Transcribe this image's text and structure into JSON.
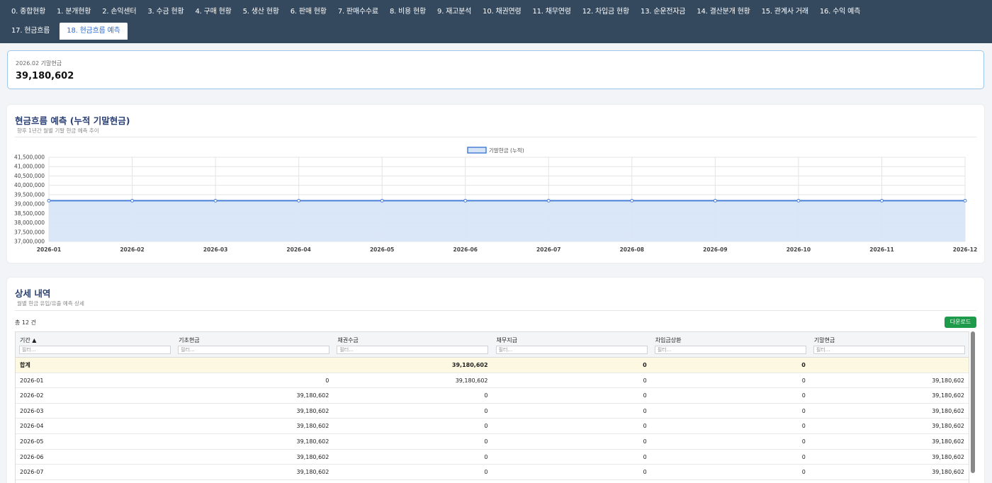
{
  "nav": {
    "tabs_row1": [
      "0. 종합현황",
      "1. 분개현황",
      "2. 손익센터",
      "3. 수금 현황",
      "4. 구매 현황",
      "5. 생산 현황",
      "6. 판매 현황",
      "7. 판매수수료",
      "8. 비용 현황",
      "9. 재고분석",
      "10. 채권연령",
      "11. 채무연령",
      "12. 차입금 현황",
      "13. 순운전자금",
      "14. 결산분개 현황",
      "15. 관계사 거래",
      "16. 수익 예측"
    ],
    "tabs_row2": [
      "17. 현금흐름",
      "18. 현금흐름 예측"
    ],
    "active": "18. 현금흐름 예측"
  },
  "kpi": {
    "label": "2026.02 기말현금",
    "value": "39,180,602"
  },
  "chart_panel": {
    "title": "현금흐름 예측 (누적 기말현금)",
    "subtitle": "향후 1년간 월별 기말 현금 예측 추이"
  },
  "chart_data": {
    "type": "area",
    "categories": [
      "2026-01",
      "2026-02",
      "2026-03",
      "2026-04",
      "2026-05",
      "2026-06",
      "2026-07",
      "2026-08",
      "2026-09",
      "2026-10",
      "2026-11",
      "2026-12"
    ],
    "series": [
      {
        "name": "기말현금 (누적)",
        "values": [
          39180602,
          39180602,
          39180602,
          39180602,
          39180602,
          39180602,
          39180602,
          39180602,
          39180602,
          39180602,
          39180602,
          39180602
        ]
      }
    ],
    "ylim": [
      37000000,
      41500000
    ],
    "yticks": [
      "41,500,000",
      "41,000,000",
      "40,500,000",
      "40,000,000",
      "39,500,000",
      "39,000,000",
      "38,500,000",
      "38,000,000",
      "37,500,000",
      "37,000,000"
    ],
    "grid": true,
    "legend": "top-center",
    "colors": {
      "line": "#4a7fd6",
      "fill": "#d6e4f8"
    }
  },
  "table_panel": {
    "title": "상세 내역",
    "subtitle": "월별 현금 유입/유출 예측 상세",
    "count": "총 12 건",
    "download": "다운로드",
    "columns": [
      "기간 ▲",
      "기초현금",
      "채권수금",
      "채무지급",
      "차입금상환",
      "기말현금"
    ],
    "filter_placeholder": "필터...",
    "total_row": [
      "합계",
      "",
      "39,180,602",
      "0",
      "0",
      ""
    ],
    "rows": [
      [
        "2026-01",
        "0",
        "39,180,602",
        "0",
        "0",
        "39,180,602"
      ],
      [
        "2026-02",
        "39,180,602",
        "0",
        "0",
        "0",
        "39,180,602"
      ],
      [
        "2026-03",
        "39,180,602",
        "0",
        "0",
        "0",
        "39,180,602"
      ],
      [
        "2026-04",
        "39,180,602",
        "0",
        "0",
        "0",
        "39,180,602"
      ],
      [
        "2026-05",
        "39,180,602",
        "0",
        "0",
        "0",
        "39,180,602"
      ],
      [
        "2026-06",
        "39,180,602",
        "0",
        "0",
        "0",
        "39,180,602"
      ],
      [
        "2026-07",
        "39,180,602",
        "0",
        "0",
        "0",
        "39,180,602"
      ]
    ]
  }
}
